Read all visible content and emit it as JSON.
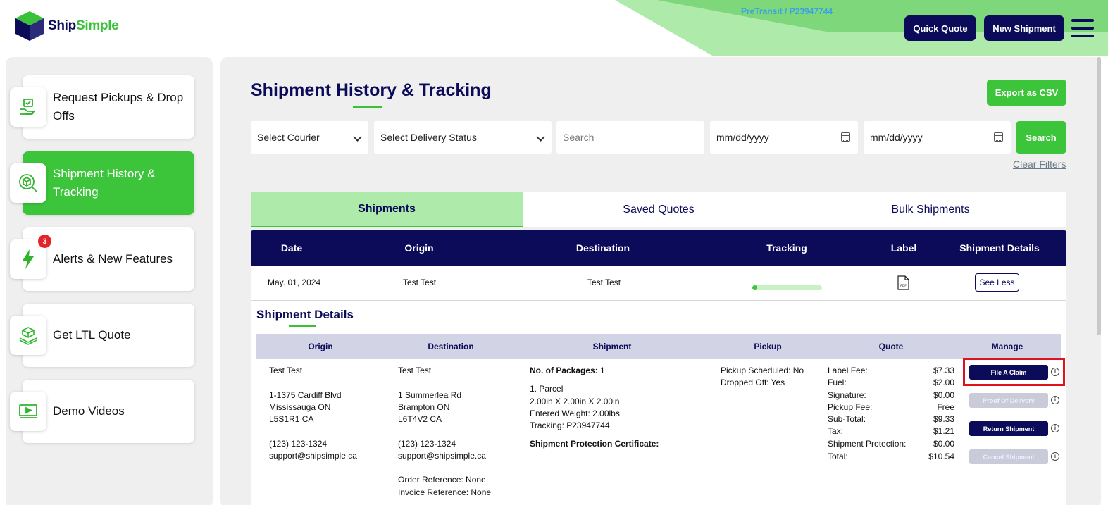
{
  "brand": {
    "name_part1": "Ship",
    "name_part2": "Simple"
  },
  "header": {
    "quick_quote": "Quick Quote",
    "new_shipment": "New Shipment"
  },
  "sidebar": {
    "items": [
      {
        "label": "Request Pickups & Drop Offs",
        "icon": "hand-package-icon"
      },
      {
        "label": "Shipment History & Tracking",
        "icon": "package-search-icon",
        "active": true
      },
      {
        "label": "Alerts & New Features",
        "icon": "lightning-icon",
        "badge": "3"
      },
      {
        "label": "Get LTL Quote",
        "icon": "pallet-icon"
      },
      {
        "label": "Demo Videos",
        "icon": "video-play-icon"
      }
    ]
  },
  "page": {
    "title": "Shipment History & Tracking",
    "export_csv": "Export as CSV",
    "filters": {
      "courier": "Select Courier",
      "status": "Select Delivery Status",
      "search_placeholder": "Search",
      "date_from": "mm/dd/yyyy",
      "date_to": "mm/dd/yyyy",
      "search_button": "Search",
      "clear": "Clear Filters"
    },
    "tabs": [
      "Shipments",
      "Saved Quotes",
      "Bulk Shipments"
    ],
    "table": {
      "columns": [
        "Date",
        "Origin",
        "Destination",
        "Tracking",
        "Label",
        "Shipment Details"
      ],
      "row": {
        "date": "May. 01, 2024",
        "origin": "Test Test",
        "destination": "Test Test",
        "tracking": "PreTransit / P23947744",
        "see_less": "See Less"
      }
    },
    "details": {
      "title": "Shipment Details",
      "columns": [
        "Origin",
        "Destination",
        "Shipment",
        "Pickup",
        "Quote",
        "Manage"
      ],
      "origin": {
        "name": "Test Test",
        "address1": "1-1375 Cardiff Blvd",
        "city": "Mississauga ON",
        "postal": "L5S1R1 CA",
        "phone": "(123) 123-1324",
        "email": "support@shipsimple.ca"
      },
      "destination": {
        "name": "Test Test",
        "address1": "1 Summerlea Rd",
        "city": "Brampton ON",
        "postal": "L6T4V2 CA",
        "phone": "(123) 123-1324",
        "email": "support@shipsimple.ca",
        "order_ref": "Order Reference: None",
        "invoice_ref": "Invoice Reference: None"
      },
      "shipment": {
        "packages_label": "No. of Packages:",
        "packages_value": "1",
        "parcel": "1. Parcel",
        "dims": "2.00in X 2.00in X 2.00in",
        "weight": "Entered Weight: 2.00lbs",
        "tracking": "Tracking: P23947744",
        "protection_cert": "Shipment Protection Certificate:"
      },
      "pickup": {
        "scheduled": "Pickup Scheduled: No",
        "dropped": "Dropped Off: Yes"
      },
      "quote": [
        {
          "label": "Label Fee:",
          "value": "$7.33"
        },
        {
          "label": "Fuel:",
          "value": "$2.00"
        },
        {
          "label": "Signature:",
          "value": "$0.00"
        },
        {
          "label": "Pickup Fee:",
          "value": "Free"
        },
        {
          "label": "Sub-Total:",
          "value": "$9.33"
        },
        {
          "label": "Tax:",
          "value": "$1.21"
        },
        {
          "label": "Shipment Protection:",
          "value": "$0.00"
        },
        {
          "label": "Total:",
          "value": "$10.54"
        }
      ],
      "manage": {
        "file_claim": "File A Claim",
        "proof_delivery": "Proof Of Delivery",
        "return_shipment": "Return Shipment",
        "cancel_shipment": "Cancel Shipment",
        "info_glyph": "i"
      }
    }
  },
  "colors": {
    "navy": "#0b0b5a",
    "green": "#3cc53a",
    "light_green": "#aeeaaa",
    "highlight": "#e0121c"
  }
}
